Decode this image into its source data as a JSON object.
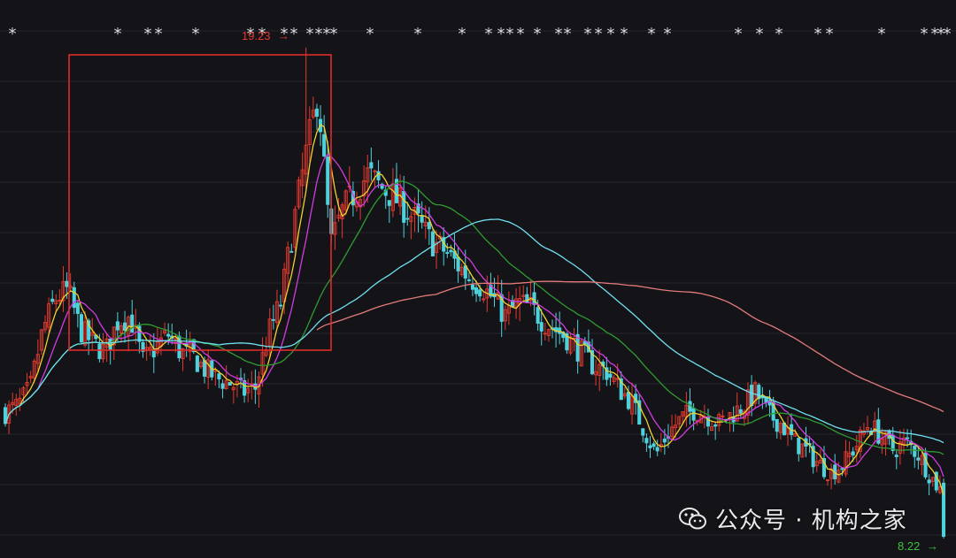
{
  "chart_data": {
    "type": "candlestick",
    "title": "",
    "xlabel": "",
    "ylabel": "",
    "ylim": [
      7.9,
      19.9
    ],
    "grid": true,
    "up_color": "#e33a2f",
    "down_color": "#4fd1dc",
    "max_label": "19.23",
    "min_label": "8.22",
    "max_value": 19.23,
    "min_value": 8.22,
    "moving_average_colors": [
      "#f2d02e",
      "#d23be0",
      "#2f9a32",
      "#6fe0ef",
      "#e37a7a"
    ],
    "highlight_box_color": "#e02b2b",
    "trend_close": [
      11.05,
      11.2,
      11.6,
      12.9,
      13.6,
      13.8,
      12.9,
      12.6,
      12.4,
      13.1,
      13.2,
      12.2,
      12.5,
      12.8,
      12.4,
      12.3,
      12.0,
      11.8,
      11.7,
      11.5,
      11.6,
      12.8,
      13.5,
      15.2,
      16.8,
      18.2,
      14.8,
      15.6,
      16.0,
      16.4,
      16.1,
      15.9,
      15.6,
      15.3,
      14.9,
      14.7,
      14.4,
      14.1,
      13.9,
      13.6,
      13.2,
      13.5,
      13.4,
      13.1,
      12.9,
      12.7,
      12.4,
      12.1,
      12.0,
      11.6,
      11.3,
      10.7,
      10.1,
      10.6,
      10.9,
      11.1,
      11.0,
      10.8,
      11.0,
      11.2,
      11.5,
      11.0,
      10.8,
      10.4,
      10.2,
      9.9,
      9.7,
      9.9,
      10.3,
      10.8,
      10.5,
      10.2,
      10.4,
      10.1,
      9.6,
      9.2
    ],
    "candle_count": 260,
    "star_markers": [
      "*",
      "*",
      "*",
      "*",
      "*",
      "*",
      "*",
      "*",
      "*",
      "*",
      "*",
      "*",
      "*",
      "*",
      "*",
      "*",
      "*",
      "*",
      "*",
      "*",
      "*",
      "*",
      "*",
      "*",
      "*",
      "*",
      "*",
      "*",
      "*",
      "*",
      "*",
      "*",
      "*",
      "*",
      "*",
      "*",
      "*",
      "*",
      "*"
    ]
  },
  "watermark": {
    "icon": "wechat-icon",
    "text": "公众号 · 机构之家"
  }
}
